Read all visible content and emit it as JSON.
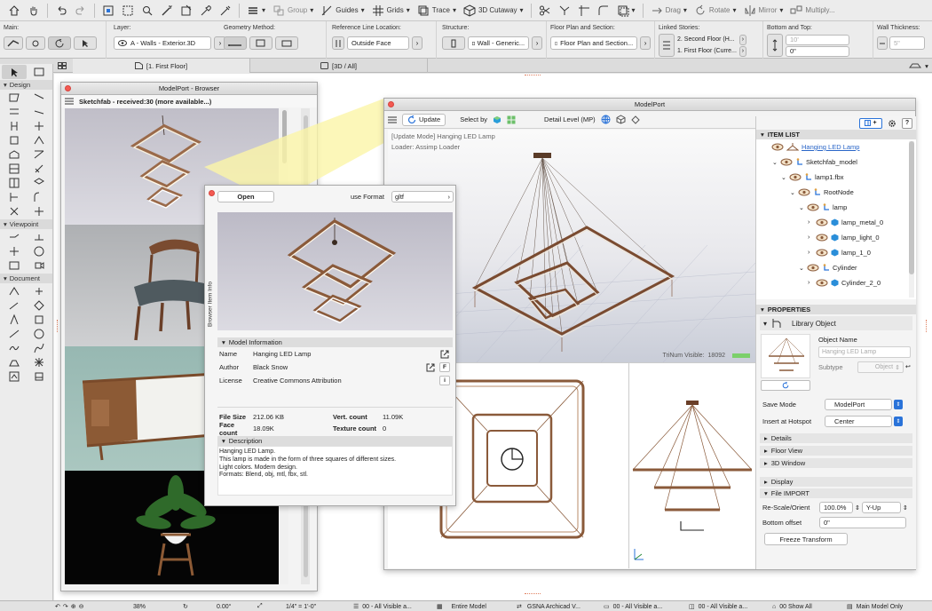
{
  "toolbar": {
    "group_label": "Group",
    "guides_label": "Guides",
    "grids_label": "Grids",
    "trace_label": "Trace",
    "cutaway_label": "3D Cutaway",
    "drag_label": "Drag",
    "rotate_label": "Rotate",
    "mirror_label": "Mirror",
    "multiply_label": "Multiply..."
  },
  "infobox": {
    "main_label": "Main:",
    "layer_label": "Layer:",
    "layer_value": "A - Walls - Exterior.3D",
    "geometry_label": "Geometry Method:",
    "refline_label": "Reference Line Location:",
    "refline_value": "Outside Face",
    "structure_label": "Structure:",
    "structure_value": "Wall - Generic...",
    "floorplan_label": "Floor Plan and Section:",
    "floorplan_value": "Floor Plan and Section...",
    "linked_label": "Linked Stories:",
    "linked_top": "2. Second Floor (H...",
    "linked_bottom": "1. First Floor (Curre...",
    "bottom_top_label": "Bottom and Top:",
    "top_value": "10'",
    "bottom_value": "0\"",
    "thickness_label": "Wall Thickness:",
    "thickness_value": "5\""
  },
  "tabs": {
    "floor_tab": "[1. First Floor]",
    "view_tab": "[3D / All]"
  },
  "toolbox": {
    "design_label": "Design",
    "viewpoint_label": "Viewpoint",
    "document_label": "Document"
  },
  "browser": {
    "title": "ModelPort - Browser",
    "header": "Sketchfab  - received:30 (more available...)"
  },
  "info_panel": {
    "open_label": "Open",
    "format_label": "use Format",
    "format_value": "gltf",
    "side_label": "Browser Item Info",
    "model_info_label": "Model Information",
    "name_label": "Name",
    "name_value": "Hanging LED Lamp",
    "author_label": "Author",
    "author_value": "Black Snow",
    "license_label": "License",
    "license_value": "Creative Commons Attribution",
    "f_btn": "F",
    "i_btn": "i",
    "filesize_label": "File Size",
    "filesize_value": "212.06 KB",
    "vert_label": "Vert. count",
    "vert_value": "11.09K",
    "face_label": "Face count",
    "face_value": "18.09K",
    "texture_label": "Texture count",
    "texture_value": "0",
    "desc_label": "Description",
    "desc_lines": [
      "Hanging LED Lamp.",
      "This lamp is made in the form of three squares of different sizes.",
      "Light colors. Modern design.",
      "Formats: Blend, obj, mtl, fbx, stl."
    ]
  },
  "modelport": {
    "title": "ModelPort",
    "update_label": "Update",
    "select_by_label": "Select by",
    "detail_label": "Detail Level (MP)",
    "update_mode": "[Update Mode]  Hanging LED Lamp",
    "loader": "Loader: Assimp Loader",
    "trinum_label": "TriNum Visible:",
    "trinum_value": "18092"
  },
  "item_list": {
    "header": "ITEM LIST",
    "items": [
      {
        "label": "Hanging LED Lamp",
        "indent": 0,
        "link": true,
        "kind": "lamp"
      },
      {
        "label": "Sketchfab_model",
        "indent": 1,
        "kind": "node"
      },
      {
        "label": "lamp1.fbx",
        "indent": 2,
        "kind": "node"
      },
      {
        "label": "RootNode",
        "indent": 3,
        "kind": "node"
      },
      {
        "label": "lamp",
        "indent": 4,
        "kind": "node"
      },
      {
        "label": "lamp_metal_0",
        "indent": 5,
        "kind": "mesh"
      },
      {
        "label": "lamp_light_0",
        "indent": 5,
        "kind": "mesh"
      },
      {
        "label": "lamp_1_0",
        "indent": 5,
        "kind": "mesh"
      },
      {
        "label": "Cylinder",
        "indent": 4,
        "kind": "node"
      },
      {
        "label": "Cylinder_2_0",
        "indent": 5,
        "kind": "mesh"
      }
    ]
  },
  "properties": {
    "header": "PROPERTIES",
    "library_object": "Library Object",
    "object_name_label": "Object Name",
    "object_name_placeholder": "Hanging LED Lamp",
    "subtype_label": "Subtype",
    "subtype_value": "Object",
    "save_mode_label": "Save Mode",
    "save_mode_value": "ModelPort",
    "hotspot_label": "Insert at Hotspot",
    "hotspot_value": "Center",
    "details_label": "Details",
    "floor_view_label": "Floor View",
    "window3d_label": "3D Window",
    "display_label": "Display",
    "file_import_label": "File IMPORT",
    "rescale_label": "Re-Scale/Orient",
    "rescale_value": "100.0%",
    "orient_value": "Y-Up",
    "bottom_offset_label": "Bottom offset",
    "bottom_offset_value": "0\"",
    "freeze_label": "Freeze Transform"
  },
  "status": {
    "zoom": "38%",
    "angle": "0.00°",
    "scale": "1/4\"  =  1'-0\"",
    "layers": "00 - All Visible a...",
    "model": "Entire Model",
    "template": "GSNA Archicad V...",
    "layers2": "00 - All Visible a...",
    "layers3": "00 - All Visible a...",
    "show_all": "00 Show All",
    "main_model": "Main Model Only"
  },
  "colors": {
    "accent": "#2a73d9",
    "link": "#2a66c8",
    "lamp_frame": "#8a5a3a",
    "close": "#f45a52"
  }
}
